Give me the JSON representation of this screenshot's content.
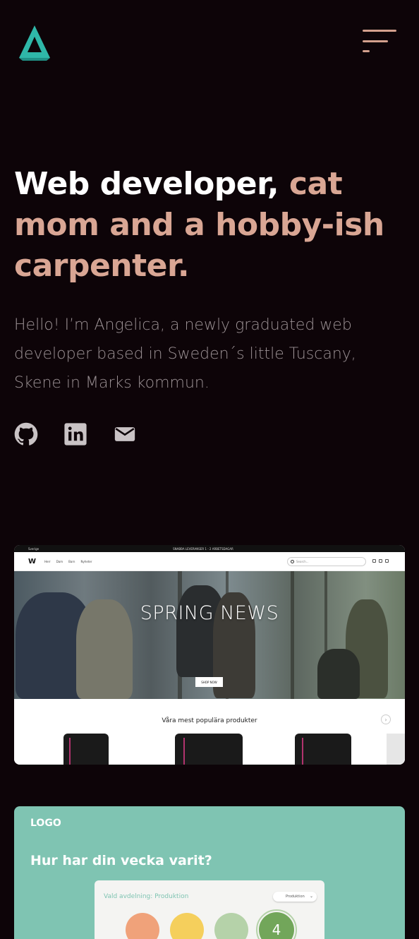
{
  "header": {
    "logo_icon": "triangle-logo-icon",
    "menu_icon": "hamburger-menu-icon"
  },
  "hero": {
    "headline_white": "Web developer, ",
    "headline_pink": "cat mom and a hobby-ish carpenter.",
    "intro": "Hello! I’m Angelica, a newly graduated web developer based in Sweden´s little Tuscany, Skene in Marks kommun."
  },
  "social": [
    {
      "icon": "github-icon"
    },
    {
      "icon": "linkedin-icon"
    },
    {
      "icon": "mail-icon"
    }
  ],
  "project1": {
    "topbar_lang": "Sverige",
    "topbar_promo": "SNABBA LEVERANSER 1 - 2 ARBETSDAGAR",
    "brand": "W",
    "nav_links": [
      "Herr",
      "Dam",
      "Barn",
      "Nyheter"
    ],
    "search_placeholder": "Search...",
    "hero_title": "SPRING NEWS",
    "shop_button": "SHOP NOW",
    "products_title": "Våra mest populära produkter"
  },
  "project2": {
    "logo": "LOGO",
    "question": "Hur har din vecka varit?",
    "department_label": "Vald avdelning: Produktion",
    "department_select": "Produktion",
    "selected_value": "4"
  },
  "colors": {
    "background": "#0d0408",
    "accent_pink": "#d9a694",
    "teal": "#2fb7a8",
    "card_green": "#7fc4b2",
    "rating_orange": "#f0a27a",
    "rating_yellow": "#f5cf5c",
    "rating_lightgreen": "#b5d2a9",
    "rating_green": "#72a65a"
  }
}
